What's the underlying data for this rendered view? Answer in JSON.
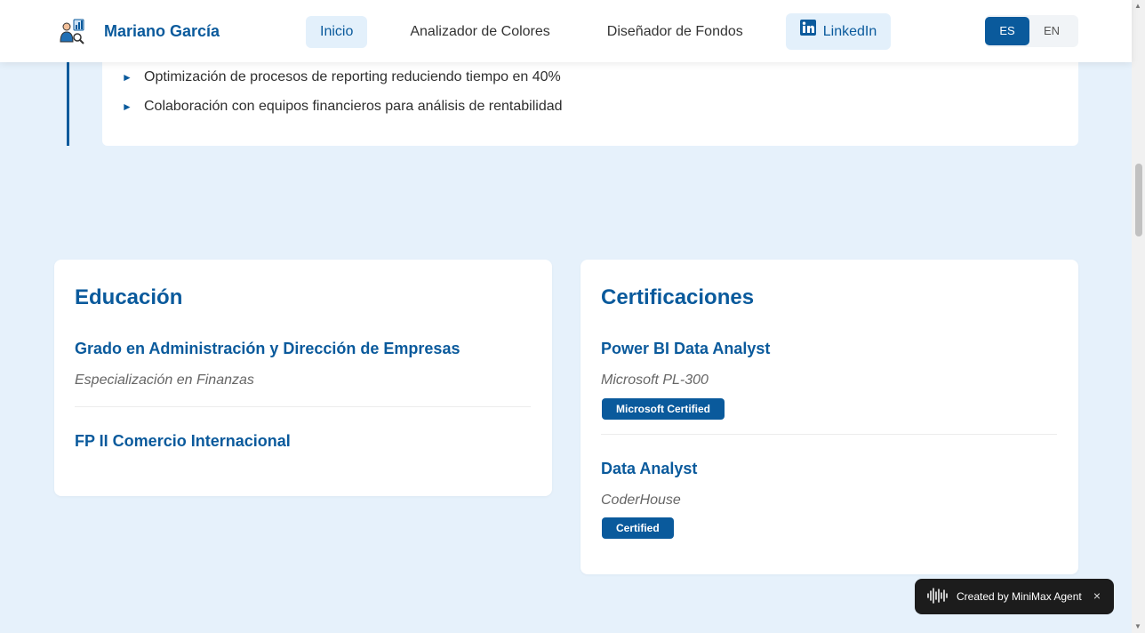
{
  "header": {
    "brand_name": "Mariano García",
    "nav": [
      {
        "label": "Inicio"
      },
      {
        "label": "Analizador de Colores"
      },
      {
        "label": "Diseñador de Fondos"
      },
      {
        "label": "LinkedIn"
      }
    ],
    "lang": {
      "es": "ES",
      "en": "EN",
      "active": "ES"
    }
  },
  "experience": {
    "bullets": [
      "Optimización de procesos de reporting reduciendo tiempo en 40%",
      "Colaboración con equipos financieros para análisis de rentabilidad"
    ]
  },
  "education": {
    "title": "Educación",
    "entries": [
      {
        "title": "Grado en Administración y Dirección de Empresas",
        "subtitle": "Especialización en Finanzas"
      },
      {
        "title": "FP II Comercio Internacional"
      }
    ]
  },
  "certifications": {
    "title": "Certificaciones",
    "entries": [
      {
        "title": "Power BI Data Analyst",
        "issuer": "Microsoft PL-300",
        "badge": "Microsoft Certified"
      },
      {
        "title": "Data Analyst",
        "issuer": "CoderHouse",
        "badge": "Certified"
      }
    ]
  },
  "toast": {
    "text": "Created by MiniMax Agent",
    "close": "×"
  },
  "colors": {
    "accent": "#0a5a9c",
    "background": "#e6f1fb",
    "toast": "#1c1c1c"
  },
  "icons": [
    "analytics-person-icon",
    "linkedin-icon",
    "arrow-bullet-icon",
    "audio-wave-icon",
    "close-icon"
  ]
}
